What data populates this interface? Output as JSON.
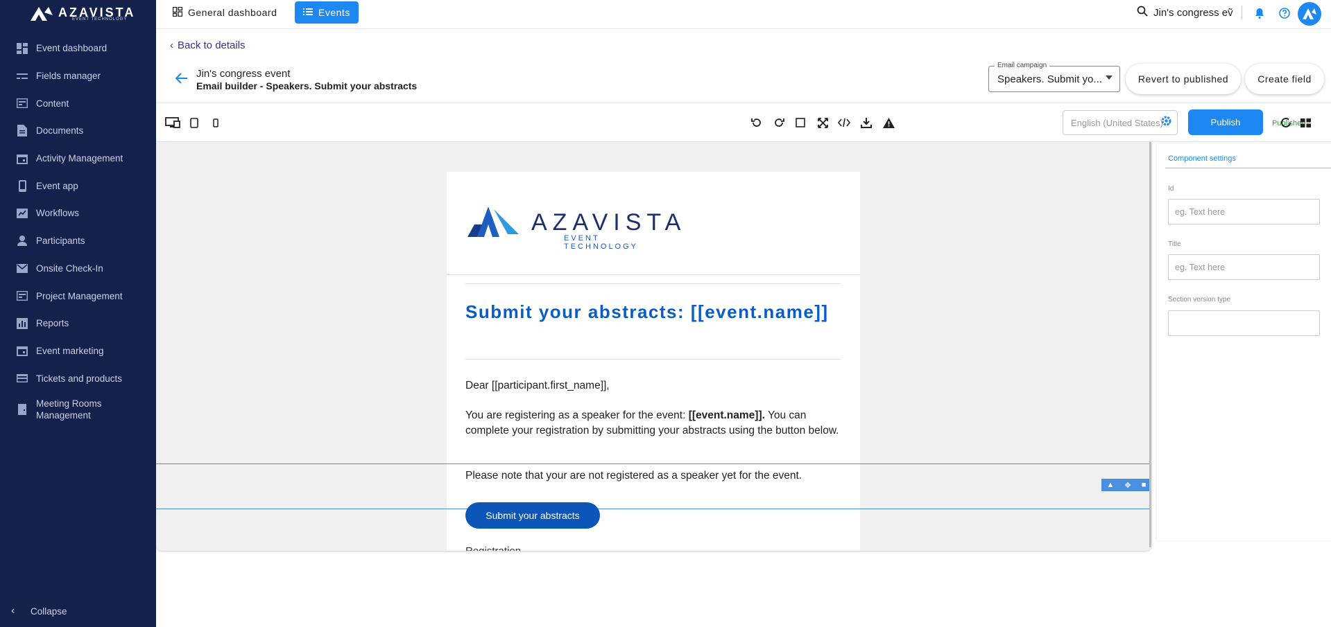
{
  "brand": {
    "name": "AZAVISTA",
    "tagline": "EVENT TECHNOLOGY",
    "accent": "#1e88f2",
    "sidebar_bg": "#14214b"
  },
  "sidebar": {
    "items": [
      {
        "label": "Event dashboard",
        "icon": "dashboard-icon"
      },
      {
        "label": "Fields manager",
        "icon": "fields-icon"
      },
      {
        "label": "Content",
        "icon": "content-icon"
      },
      {
        "label": "Documents",
        "icon": "document-icon"
      },
      {
        "label": "Activity Management",
        "icon": "calendar-icon"
      },
      {
        "label": "Event app",
        "icon": "phone-icon"
      },
      {
        "label": "Workflows",
        "icon": "workflow-icon"
      },
      {
        "label": "Participants",
        "icon": "person-icon"
      },
      {
        "label": "Onsite Check-In",
        "icon": "mail-icon"
      },
      {
        "label": "Project Management",
        "icon": "project-icon"
      },
      {
        "label": "Reports",
        "icon": "chart-icon"
      },
      {
        "label": "Event marketing",
        "icon": "calendar-icon"
      },
      {
        "label": "Tickets and products",
        "icon": "card-icon"
      },
      {
        "label": "Meeting Rooms Management",
        "icon": "room-icon"
      }
    ],
    "collapse_label": "Collapse"
  },
  "topbar": {
    "general_tab": "General dashboard",
    "events_tab": "Events",
    "search_text": "Jin's congress eṽ"
  },
  "header": {
    "back_link": "Back to details",
    "event_name": "Jin's congress event",
    "builder_title": "Email builder - Speakers. Submit your abstracts",
    "campaign_label": "Email campaign",
    "campaign_value": "Speakers. Submit yo...",
    "revert_label": "Revert to published",
    "create_field_label": "Create field"
  },
  "toolbar": {
    "language": "English (United States)",
    "publish_label": "Publish",
    "status": "Published"
  },
  "email": {
    "logo_text": "AZAVISTA",
    "logo_sub": "EVENT TECHNOLOGY",
    "heading": "Submit your abstracts: [[event.name]]",
    "greeting": "Dear [[participant.first_name]],",
    "p1_before": "You are registering as a speaker for the event: ",
    "p1_bold": "[[event.name]].",
    "p1_after": " You can complete your registration by submitting your abstracts using the button below.",
    "p2": "Please note that your are not registered as a speaker yet for the event.",
    "cta_label": "Submit your abstracts",
    "cut_text": "Registration"
  },
  "panel": {
    "title": "Component settings",
    "id_label": "Id",
    "id_placeholder": "eg. Text here",
    "title_label": "Title",
    "title_placeholder": "eg. Text here",
    "section_label": "Section version type",
    "section_value": ""
  }
}
